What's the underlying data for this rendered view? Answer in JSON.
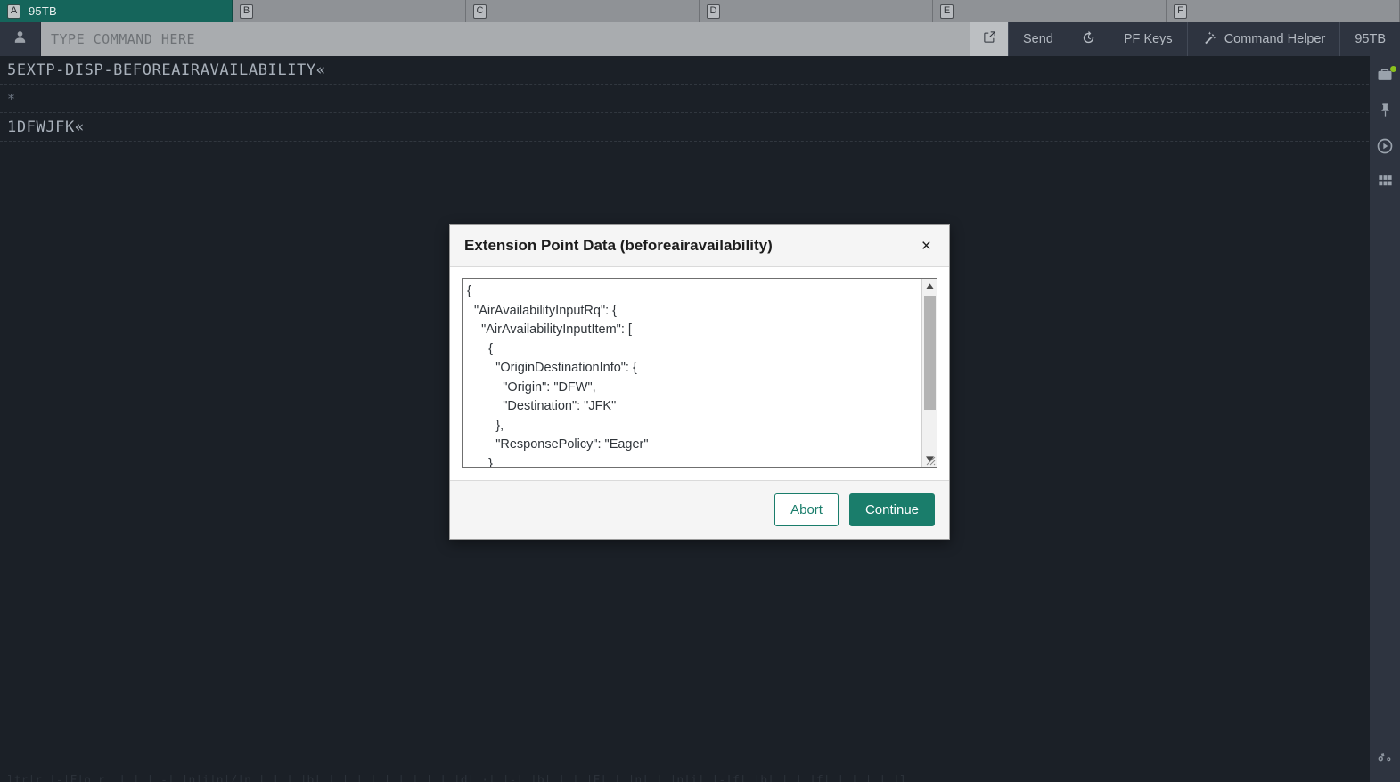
{
  "tabs": [
    {
      "badge": "A",
      "label": "95TB",
      "active": true
    },
    {
      "badge": "B",
      "label": "",
      "active": false
    },
    {
      "badge": "C",
      "label": "",
      "active": false
    },
    {
      "badge": "D",
      "label": "",
      "active": false
    },
    {
      "badge": "E",
      "label": "",
      "active": false
    },
    {
      "badge": "F",
      "label": "",
      "active": false
    }
  ],
  "commandbar": {
    "user_icon": "user-icon",
    "input_value": "",
    "input_placeholder": "TYPE COMMAND HERE",
    "expand_icon": "external-link-icon",
    "send_label": "Send",
    "history_icon": "history-icon",
    "pfkeys_label": "PF Keys",
    "command_helper_icon": "magic-wand-icon",
    "command_helper_label": "Command Helper",
    "session_label": "95TB"
  },
  "terminal": {
    "lines": [
      "5EXTP-DISP-BEFOREAIRAVAILABILITY«",
      "*",
      "1DFWJFK«"
    ],
    "bottom_line": "ltr|r |-|F|o.r. |.|.|.-|.|n|i|n|/|n.|.|.|.|b|.|.|.|.|.|.|.|.|.|.|d|.·|.|-|.|b|.|.|.|F|.|.|n|.|.|n|i|.|-|f|.|b|.|.|.|f|.|.|.|.|.|l"
  },
  "rail": {
    "icons": [
      {
        "name": "briefcase-icon",
        "badge": true
      },
      {
        "name": "pin-icon",
        "badge": false
      },
      {
        "name": "play-circle-icon",
        "badge": false
      },
      {
        "name": "grid-icon",
        "badge": false
      }
    ],
    "bottom_icon": "cogs-icon"
  },
  "modal": {
    "title": "Extension Point Data (beforeairavailability)",
    "close_label": "×",
    "json_text": "{\n  \"AirAvailabilityInputRq\": {\n    \"AirAvailabilityInputItem\": [\n      {\n        \"OriginDestinationInfo\": {\n          \"Origin\": \"DFW\",\n          \"Destination\": \"JFK\"\n        },\n        \"ResponsePolicy\": \"Eager\"\n      }",
    "abort_label": "Abort",
    "continue_label": "Continue"
  },
  "colors": {
    "accent_teal": "#1a7d6b",
    "active_tab": "#15655b",
    "terminal_bg": "#1b2027",
    "chrome_dark": "#2e3440",
    "badge_green": "#8ac11d"
  }
}
